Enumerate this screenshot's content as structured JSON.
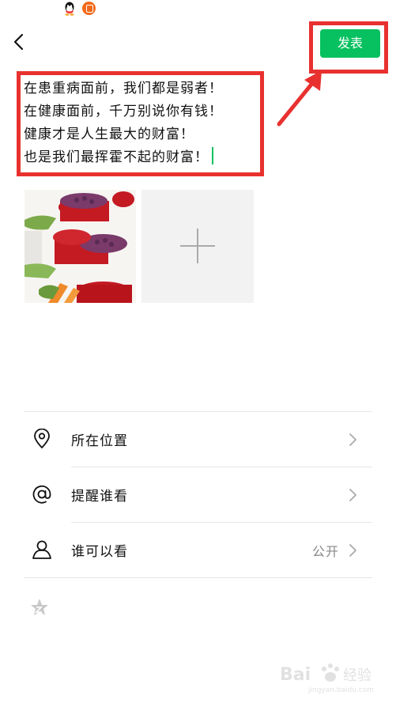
{
  "status_bar": {
    "icons": [
      "qq-icon",
      "notification-icon"
    ]
  },
  "header": {
    "back_icon": "chevron-left-icon",
    "publish_label": "发表",
    "accent_color": "#07c160"
  },
  "post": {
    "lines": [
      "在患重病面前，我们都是弱者！",
      "在健康面前，千万别说你有钱！",
      "健康才是人生最大的财富！",
      "也是我们最挥霍不起的财富！"
    ]
  },
  "media": {
    "add_icon": "plus-icon"
  },
  "options": [
    {
      "icon": "location-pin-icon",
      "label": "所在位置",
      "value": ""
    },
    {
      "icon": "at-sign-icon",
      "label": "提醒谁看",
      "value": ""
    },
    {
      "icon": "person-icon",
      "label": "谁可以看",
      "value": "公开"
    }
  ],
  "extra": {
    "icon": "star-icon"
  },
  "annotation_color": "#e8312f",
  "watermark": {
    "text": "Bai 经验",
    "sub": "jingyan.baidu.com"
  }
}
